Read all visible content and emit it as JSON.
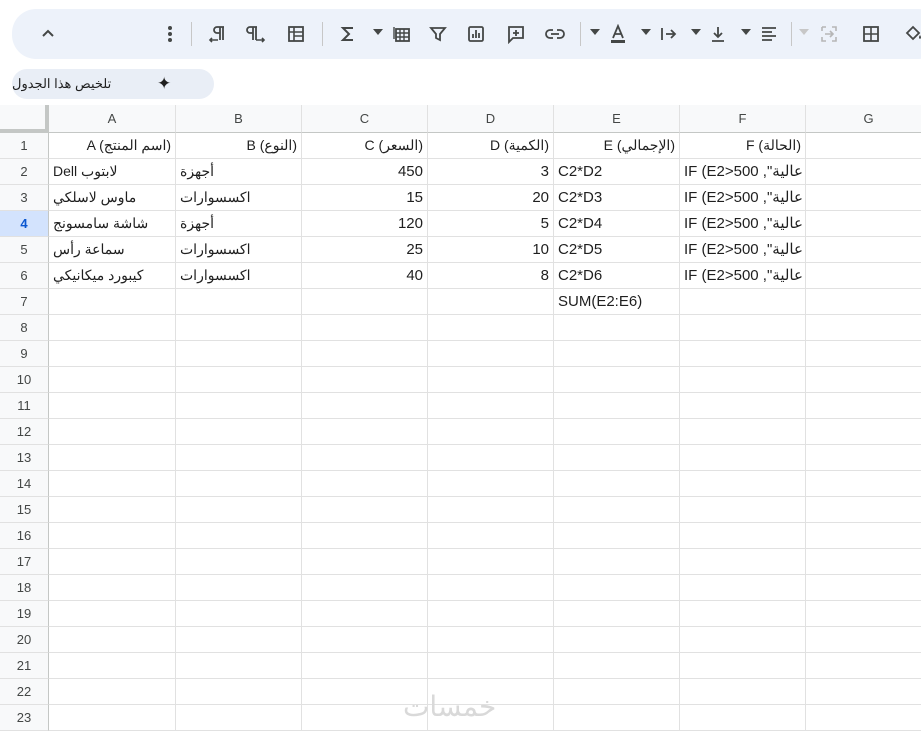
{
  "toolbar": {
    "icons": [
      "chevron-up-icon",
      "more-vert-icon",
      "ltr-text-icon",
      "rtl-text-icon",
      "pivot-icon",
      "sigma-icon",
      "functions-dropdown-icon",
      "filter-icon",
      "chart-icon",
      "comment-icon",
      "link-icon",
      "text-color-icon",
      "text-direction-icon",
      "vertical-align-icon",
      "horizontal-align-icon",
      "merge-icon",
      "borders-icon",
      "fill-color-icon"
    ]
  },
  "chip": {
    "label": "تلخيص هذا الجدول"
  },
  "columns": [
    "A",
    "B",
    "C",
    "D",
    "E",
    "F",
    "G"
  ],
  "rows": [
    "1",
    "2",
    "3",
    "4",
    "5",
    "6",
    "7",
    "8",
    "9",
    "10",
    "11",
    "12",
    "13",
    "14",
    "15",
    "16",
    "17",
    "18",
    "19",
    "20",
    "21",
    "22",
    "23"
  ],
  "cells": {
    "r1": [
      "A (اسم المنتج)",
      "B (النوع)",
      "C (السعر)",
      "D (الكمية)",
      "E (الإجمالي)",
      "F (الحالة)"
    ],
    "r2": [
      "لابتوب Dell",
      "أجهزة",
      "450",
      "3",
      "C2*D2",
      "IF (E2>500 ,\"عالية"
    ],
    "r3": [
      "ماوس لاسلكي",
      "اكسسوارات",
      "15",
      "20",
      "C2*D3",
      "IF (E2>500 ,\"عالية"
    ],
    "r4": [
      "شاشة سامسونج",
      "أجهزة",
      "120",
      "5",
      "C2*D4",
      "IF (E2>500 ,\"عالية"
    ],
    "r5": [
      "سماعة رأس",
      "اكسسوارات",
      "25",
      "10",
      "C2*D5",
      "IF (E2>500 ,\"عالية"
    ],
    "r6": [
      "كيبورد ميكانيكي",
      "اكسسوارات",
      "40",
      "8",
      "C2*D6",
      "IF (E2>500 ,\"عالية"
    ],
    "r7": [
      "",
      "",
      "",
      "",
      "SUM(E2:E6)",
      ""
    ]
  },
  "watermark": "خمسات",
  "selected_row": "4"
}
